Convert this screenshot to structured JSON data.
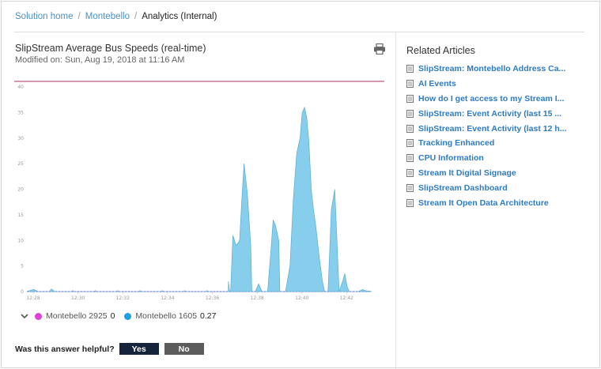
{
  "breadcrumb": {
    "items": [
      "Solution home",
      "Montebello"
    ],
    "current": "Analytics (Internal)"
  },
  "chart_panel": {
    "title": "SlipStream Average Bus Speeds (real-time)",
    "modified": "Modified on: Sun, Aug 19, 2018 at 11:16 AM"
  },
  "chart_data": {
    "type": "area",
    "title": "",
    "xlabel": "",
    "ylabel": "",
    "ylim": [
      0,
      40
    ],
    "y_ticks": [
      "0",
      "5",
      "10",
      "15",
      "20",
      "25",
      "30",
      "35",
      "40"
    ],
    "x_ticks": [
      "12:28",
      "12:30",
      "12:32",
      "12:34",
      "12:36",
      "12:38",
      "12:40",
      "12:42"
    ],
    "x_range_minutes": [
      0,
      15.4
    ],
    "series": [
      {
        "name": "Montebello 2925",
        "color": "#e040d8",
        "style": "dashed-line",
        "points": [
          [
            0,
            0
          ],
          [
            15.4,
            0
          ]
        ]
      },
      {
        "name": "Montebello 1605",
        "color": "#87cdec",
        "style": "area",
        "points": [
          [
            0,
            0
          ],
          [
            0.2,
            0.3
          ],
          [
            0.3,
            0.4
          ],
          [
            0.5,
            0
          ],
          [
            1.0,
            0
          ],
          [
            1.1,
            0.5
          ],
          [
            1.25,
            0
          ],
          [
            2.0,
            0
          ],
          [
            2.05,
            0.2
          ],
          [
            2.1,
            0
          ],
          [
            3.0,
            0
          ],
          [
            3.05,
            0.2
          ],
          [
            3.1,
            0
          ],
          [
            4.0,
            0
          ],
          [
            4.05,
            0.2
          ],
          [
            4.1,
            0
          ],
          [
            5.0,
            0
          ],
          [
            5.05,
            0.2
          ],
          [
            5.1,
            0
          ],
          [
            6.0,
            0
          ],
          [
            6.05,
            0.2
          ],
          [
            6.1,
            0
          ],
          [
            7.0,
            0
          ],
          [
            7.05,
            0.2
          ],
          [
            7.1,
            0
          ],
          [
            8.0,
            0
          ],
          [
            8.05,
            0.2
          ],
          [
            8.1,
            0
          ],
          [
            9.0,
            0
          ],
          [
            9.05,
            0.2
          ],
          [
            9.1,
            0
          ],
          [
            8.8,
            0
          ],
          [
            9.0,
            2
          ],
          [
            9.2,
            11
          ],
          [
            9.35,
            9
          ],
          [
            9.5,
            10
          ],
          [
            9.6,
            18
          ],
          [
            9.7,
            25
          ],
          [
            9.85,
            19
          ],
          [
            10.0,
            9
          ],
          [
            10.05,
            0
          ],
          [
            10.2,
            0
          ],
          [
            10.35,
            1.5
          ],
          [
            10.5,
            0
          ],
          [
            10.75,
            0
          ],
          [
            10.9,
            8
          ],
          [
            11.0,
            14
          ],
          [
            11.1,
            13
          ],
          [
            11.25,
            10
          ],
          [
            11.3,
            0
          ],
          [
            11.55,
            0
          ],
          [
            11.75,
            5
          ],
          [
            11.9,
            18
          ],
          [
            12.05,
            27
          ],
          [
            12.2,
            30
          ],
          [
            12.3,
            35
          ],
          [
            12.4,
            36
          ],
          [
            12.5,
            34
          ],
          [
            12.6,
            29
          ],
          [
            12.7,
            20
          ],
          [
            12.8,
            16
          ],
          [
            12.9,
            13
          ],
          [
            13.05,
            7
          ],
          [
            13.2,
            2
          ],
          [
            13.3,
            0
          ],
          [
            13.45,
            0
          ],
          [
            13.6,
            16
          ],
          [
            13.75,
            20
          ],
          [
            13.85,
            10
          ],
          [
            13.95,
            0
          ],
          [
            14.1,
            2
          ],
          [
            14.2,
            3.5
          ],
          [
            14.3,
            1
          ],
          [
            14.4,
            0
          ],
          [
            14.8,
            0
          ],
          [
            15.0,
            0.4
          ],
          [
            15.1,
            0.2
          ],
          [
            15.4,
            0
          ]
        ]
      }
    ],
    "reference_line": {
      "value": 40,
      "color": "#b03060"
    }
  },
  "legend": {
    "entries": [
      {
        "name": "Montebello 2925",
        "value": "0",
        "color": "#e040d8"
      },
      {
        "name": "Montebello 1605",
        "value": "0.27",
        "color": "#1aa0e8"
      }
    ]
  },
  "feedback": {
    "question": "Was this answer helpful?",
    "yes_label": "Yes",
    "no_label": "No"
  },
  "related": {
    "heading": "Related Articles",
    "articles": [
      "SlipStream: Montebello Address Ca...",
      "AI Events",
      "How do I get access to my Stream I...",
      "SlipStream: Event Activity (last 15 ...",
      "SlipStream: Event Activity (last 12 h...",
      "Tracking Enhanced",
      "CPU Information",
      "Stream It Digital Signage",
      "SlipStream Dashboard",
      "Stream It Open Data Architecture"
    ]
  }
}
